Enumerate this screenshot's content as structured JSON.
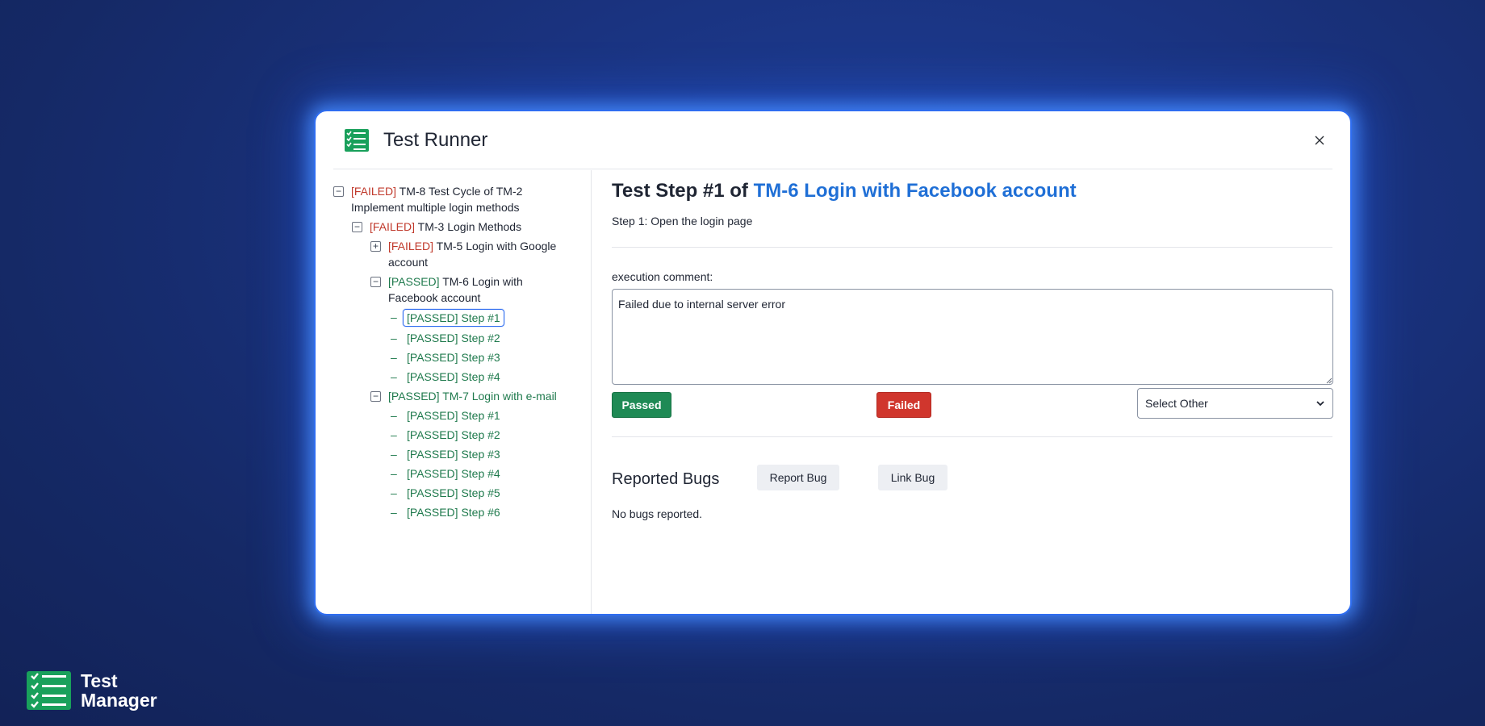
{
  "app": {
    "brand_line1": "Test",
    "brand_line2": "Manager",
    "logo_icon": "checklist-icon",
    "brand_color": "#19a05b"
  },
  "modal": {
    "title": "Test Runner",
    "close_icon": "close-icon"
  },
  "tree": {
    "nodes": [
      {
        "status": "[FAILED]",
        "text": "TM-8 Test Cycle of TM-2 Implement multiple login methods",
        "toggle": "−"
      },
      {
        "status": "[FAILED]",
        "text": "TM-3 Login Methods",
        "toggle": "−"
      },
      {
        "status": "[FAILED]",
        "text": "TM-5 Login with Google account",
        "toggle": "+"
      },
      {
        "status": "[PASSED]",
        "text": "TM-6 Login with Facebook account",
        "toggle": "−"
      },
      {
        "status": "[PASSED]",
        "text": "Step #1",
        "toggle": "–"
      },
      {
        "status": "[PASSED]",
        "text": "Step #2",
        "toggle": "–"
      },
      {
        "status": "[PASSED]",
        "text": "Step #3",
        "toggle": "–"
      },
      {
        "status": "[PASSED]",
        "text": "Step #4",
        "toggle": "–"
      },
      {
        "status": "[PASSED]",
        "text": "TM-7 Login with e-mail",
        "toggle": "−"
      },
      {
        "status": "[PASSED]",
        "text": "Step #1",
        "toggle": "–"
      },
      {
        "status": "[PASSED]",
        "text": "Step #2",
        "toggle": "–"
      },
      {
        "status": "[PASSED]",
        "text": "Step #3",
        "toggle": "–"
      },
      {
        "status": "[PASSED]",
        "text": "Step #4",
        "toggle": "–"
      },
      {
        "status": "[PASSED]",
        "text": "Step #5",
        "toggle": "–"
      },
      {
        "status": "[PASSED]",
        "text": "Step #6",
        "toggle": "–"
      }
    ]
  },
  "detail": {
    "title_prefix": "Test Step #1 of ",
    "title_link": "TM-6 Login with Facebook account",
    "step_description": "Step 1: Open the login page",
    "comment_label": "execution comment:",
    "comment_value": "Failed due to internal server error",
    "passed_label": "Passed",
    "failed_label": "Failed",
    "select_other": "Select Other",
    "bugs_title": "Reported Bugs",
    "report_bug_label": "Report Bug",
    "link_bug_label": "Link Bug",
    "no_bugs": "No bugs reported.",
    "colors": {
      "passed": "#1f8a55",
      "failed": "#d0362d",
      "link": "#1f6fd6"
    }
  }
}
